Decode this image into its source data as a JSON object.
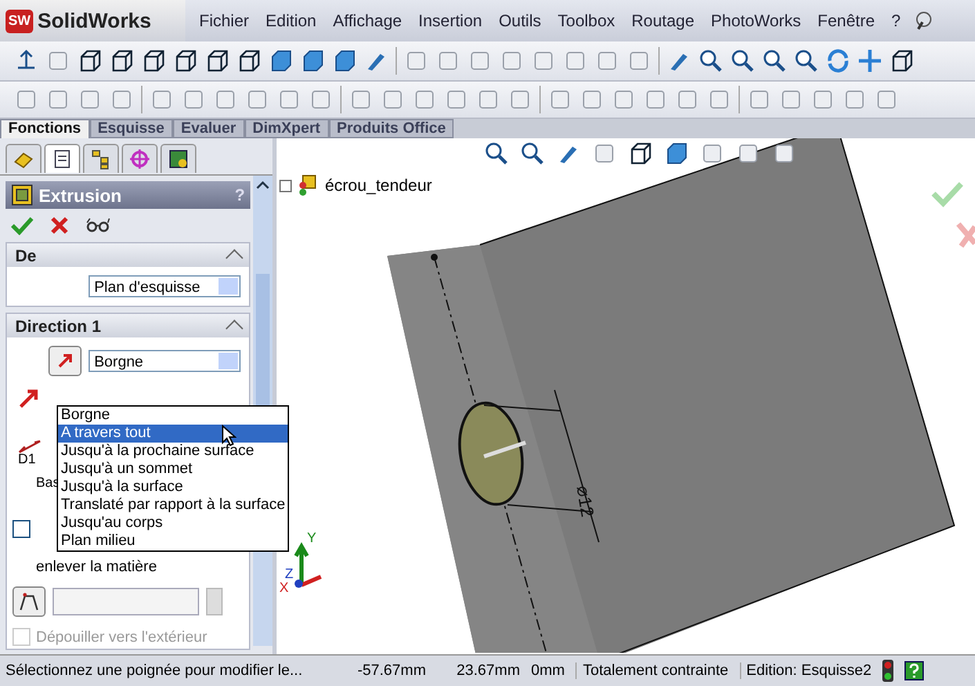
{
  "app": {
    "logo_badge": "SW",
    "logo": "SolidWorks"
  },
  "menu": [
    "Fichier",
    "Edition",
    "Affichage",
    "Insertion",
    "Outils",
    "Toolbox",
    "Routage",
    "PhotoWorks",
    "Fenêtre",
    "?"
  ],
  "command_tabs": [
    {
      "label": "Fonctions",
      "selected": true
    },
    {
      "label": "Esquisse",
      "selected": false
    },
    {
      "label": "Evaluer",
      "selected": false
    },
    {
      "label": "DimXpert",
      "selected": false
    },
    {
      "label": "Produits Office",
      "selected": false
    }
  ],
  "panel_tabs": [
    {
      "selected": false
    },
    {
      "selected": true
    },
    {
      "selected": false
    },
    {
      "selected": false
    },
    {
      "selected": false
    }
  ],
  "property_manager": {
    "title": "Extrusion",
    "help": "?"
  },
  "from_section": {
    "title": "De",
    "value": "Plan d'esquisse"
  },
  "direction_section": {
    "title": "Direction 1",
    "value": "Borgne",
    "depth_label": "D1",
    "flip_label": [
      "Bas",
      "enlever la matière"
    ],
    "flip_checked": false,
    "draft_label": "Dépouiller vers l'extérieur",
    "draft_checked": false,
    "draft_disabled": true
  },
  "dropdown_options": [
    {
      "label": "Borgne",
      "selected": false
    },
    {
      "label": "A travers tout",
      "selected": true
    },
    {
      "label": "Jusqu'à la prochaine surface",
      "selected": false
    },
    {
      "label": "Jusqu'à un sommet",
      "selected": false
    },
    {
      "label": "Jusqu'à la surface",
      "selected": false
    },
    {
      "label": "Translaté par rapport à la surface",
      "selected": false
    },
    {
      "label": "Jusqu'au corps",
      "selected": false
    },
    {
      "label": "Plan milieu",
      "selected": false
    }
  ],
  "viewport": {
    "tree_root": "écrou_tendeur",
    "dimension": "⌀12",
    "axes": [
      "X",
      "Y",
      "Z"
    ]
  },
  "status_bar": {
    "message": "Sélectionnez une poignée pour modifier le...",
    "x": "-57.67mm",
    "y": "23.67mm",
    "z": "0mm",
    "state": "Totalement contrainte",
    "editing": "Edition: Esquisse2"
  }
}
